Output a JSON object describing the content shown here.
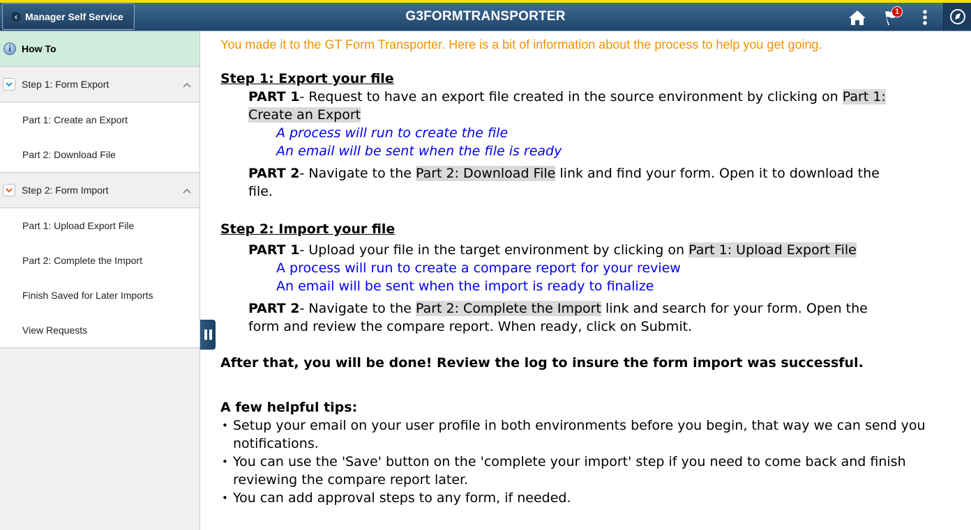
{
  "header": {
    "back_label": "Manager Self Service",
    "title": "G3FORMTRANSPORTER",
    "notification_count": "1",
    "icons": [
      "home-icon",
      "flag-icon",
      "more-vertical-icon",
      "navbar-compass-icon"
    ]
  },
  "sidebar": {
    "how_to": "How To",
    "groups": [
      {
        "label": "Step 1: Form Export",
        "icon_color": "#2a9fd8",
        "items": [
          "Part 1: Create an Export",
          "Part 2: Download File"
        ]
      },
      {
        "label": "Step 2: Form Import",
        "icon_color": "#e8612c",
        "items": [
          "Part 1: Upload Export File",
          "Part 2: Complete the Import",
          "Finish Saved for Later Imports",
          "View Requests"
        ]
      }
    ]
  },
  "content": {
    "intro": "You made it to the GT Form Transporter. Here is a bit of information about the process to help you get going.",
    "step1": {
      "heading": "Step 1:  Export your file ",
      "part1_label": "PART 1",
      "part1_dash": "-  ",
      "part1_text": "Request to have an export file created in the source environment by clicking on ",
      "part1_link_a": "Part 1: ",
      "part1_link_b": "Create an Export",
      "note1": "A process will run to create the file",
      "note2": "An email will be sent when the file is ready",
      "part2_label": "PART 2",
      "part2_dash": "-  ",
      "part2_pre": "Navigate to the ",
      "part2_link": "Part 2:  Download File",
      "part2_post": " link and find your form. Open it to download the",
      "part2_cont": "file."
    },
    "step2": {
      "heading": "Step 2: Import your file ",
      "part1_label": "PART 1",
      "part1_dash": "-  ",
      "part1_text": "Upload your file in the target environment by clicking on ",
      "part1_link": "Part 1:  Upload Export File",
      "note1": "A process will run to create a compare report for your review",
      "note2": "An email will be sent when the import is ready to finalize",
      "part2_label": "PART 2",
      "part2_dash": "-  ",
      "part2_pre": "Navigate to the ",
      "part2_link": "Part 2:  Complete the Import",
      "part2_post": " link and search for your form. Open the",
      "part2_cont": "form and review the compare report. When ready, click on Submit."
    },
    "done": "After that, you will be done! Review the log to insure the form import was successful.",
    "tips_heading": "A few helpful tips:",
    "tips": [
      "Setup your email on your user profile in both environments before you begin, that way we can send you notifications.",
      "You can use the 'Save' button on the 'complete your import' step if you need to come back and finish reviewing the compare report later.",
      "You can add approval steps to any form, if needed."
    ]
  }
}
